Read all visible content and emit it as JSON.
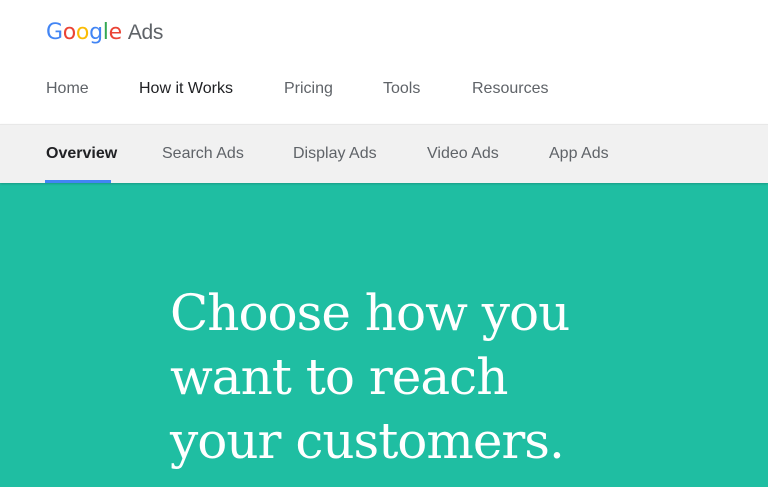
{
  "brand": {
    "logo_letters": [
      {
        "char": "G",
        "color": "#4285F4"
      },
      {
        "char": "o",
        "color": "#EA4335"
      },
      {
        "char": "o",
        "color": "#FBBC05"
      },
      {
        "char": "g",
        "color": "#4285F4"
      },
      {
        "char": "l",
        "color": "#34A853"
      },
      {
        "char": "e",
        "color": "#EA4335"
      }
    ],
    "product_name": "Ads"
  },
  "primary_nav": {
    "items": [
      {
        "label": "Home",
        "active": false
      },
      {
        "label": "How it Works",
        "active": true
      },
      {
        "label": "Pricing",
        "active": false
      },
      {
        "label": "Tools",
        "active": false
      },
      {
        "label": "Resources",
        "active": false
      }
    ]
  },
  "sub_nav": {
    "items": [
      {
        "label": "Overview",
        "active": true
      },
      {
        "label": "Search Ads",
        "active": false
      },
      {
        "label": "Display Ads",
        "active": false
      },
      {
        "label": "Video Ads",
        "active": false
      },
      {
        "label": "App Ads",
        "active": false
      }
    ],
    "active_indicator_color": "#4285F4"
  },
  "hero": {
    "background_color": "#1FBEA2",
    "headline_lines": [
      "Choose how you",
      "want to reach",
      "your customers."
    ]
  }
}
